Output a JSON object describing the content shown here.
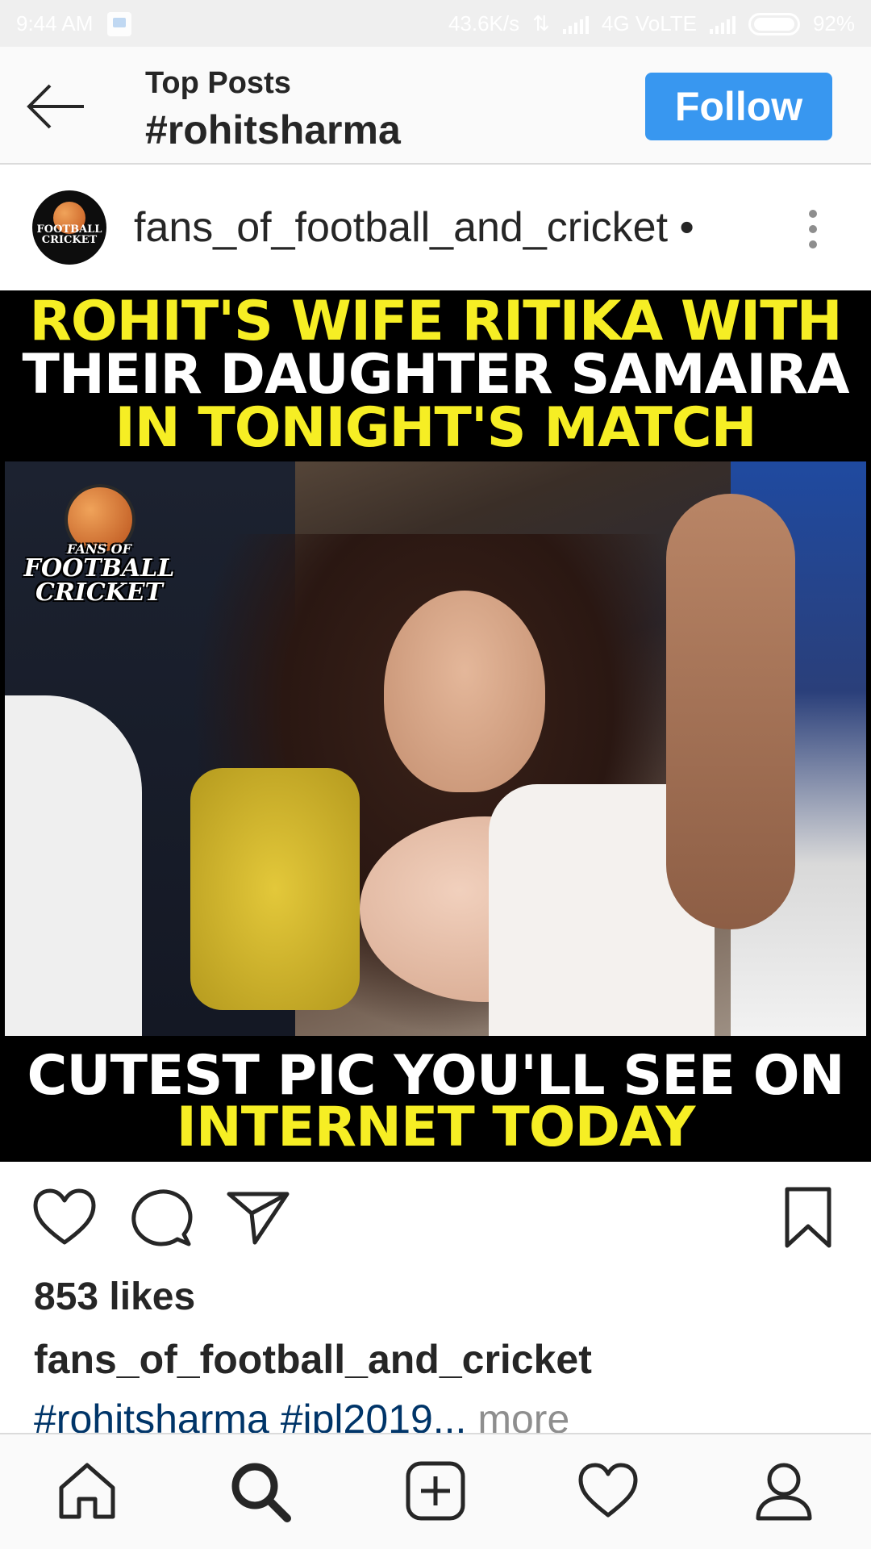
{
  "status_bar": {
    "time": "9:44 AM",
    "speed": "43.6K/s",
    "network": "4G VoLTE",
    "battery": "92%"
  },
  "header": {
    "subtitle": "Top Posts",
    "title": "#rohitsharma",
    "follow_label": "Follow",
    "back_icon": "arrow-left-icon"
  },
  "post": {
    "username": "fans_of_football_and_cricket",
    "username_suffix": "•",
    "avatar_text": "FOOTBALL CRICKET",
    "image": {
      "banner_top": [
        {
          "text": "ROHIT'S WIFE RITIKA WITH",
          "color": "#f6ee24"
        },
        {
          "text": "THEIR DAUGHTER SAMAIRA",
          "color": "#ffffff"
        },
        {
          "text": "IN TONIGHT'S MATCH",
          "color": "#f6ee24"
        }
      ],
      "logo_small": "FANS OF",
      "logo_line1": "FOOTBALL",
      "logo_line2": "CRICKET",
      "banner_bottom": [
        {
          "text": "CUTEST PIC YOU'LL SEE ON",
          "color": "#ffffff"
        },
        {
          "text": "INTERNET TODAY",
          "color": "#f6ee24"
        }
      ]
    },
    "likes": "853 likes",
    "caption_user": "fans_of_football_and_cricket",
    "caption_tags": "#rohitsharma #ipl2019",
    "caption_ellipsis": "...",
    "caption_more": " more"
  },
  "colors": {
    "accent": "#3897f0",
    "hashtag": "#003569",
    "muted": "#8e8e8e"
  },
  "bottom_nav": [
    {
      "name": "home-icon"
    },
    {
      "name": "search-icon"
    },
    {
      "name": "add-post-icon"
    },
    {
      "name": "activity-heart-icon"
    },
    {
      "name": "profile-icon"
    }
  ]
}
